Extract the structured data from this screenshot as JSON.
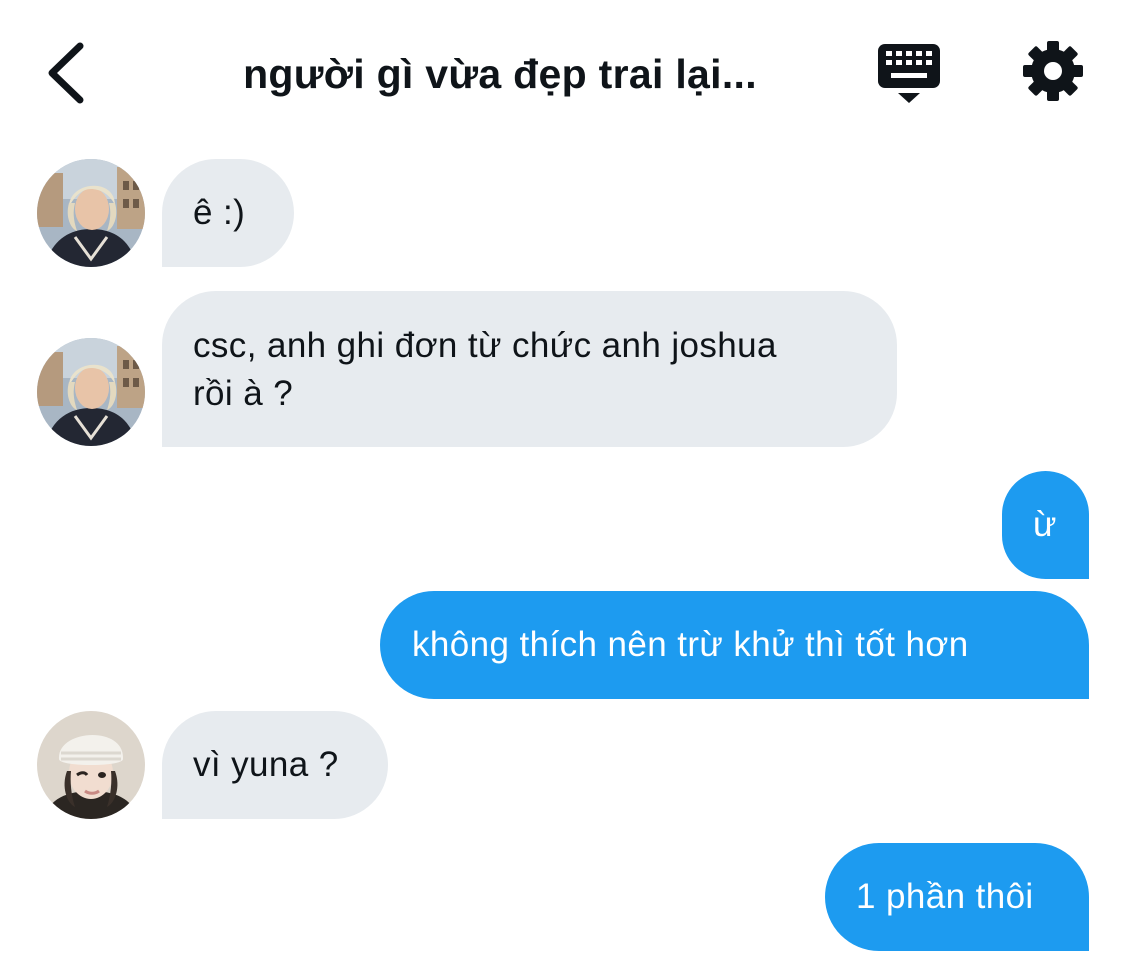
{
  "header": {
    "title": "người gì vừa đẹp trai lại..."
  },
  "icons": {
    "back": "chevron-left-icon",
    "keyboard": "keyboard-icon",
    "settings": "gear-icon"
  },
  "colors": {
    "outgoing_bubble": "#1d9bf0",
    "incoming_bubble": "#e7ebef",
    "text": "#0f1419"
  },
  "messages": [
    {
      "direction": "incoming",
      "text": "ê :)"
    },
    {
      "direction": "incoming",
      "text": "csc, anh ghi đơn từ chức anh joshua\nrồi à ?"
    },
    {
      "direction": "outgoing",
      "text": "ừ"
    },
    {
      "direction": "outgoing",
      "text": "không thích nên trừ khử thì tốt hơn"
    },
    {
      "direction": "incoming",
      "text": "vì yuna ?"
    },
    {
      "direction": "outgoing",
      "text": "1 phần thôi"
    }
  ]
}
